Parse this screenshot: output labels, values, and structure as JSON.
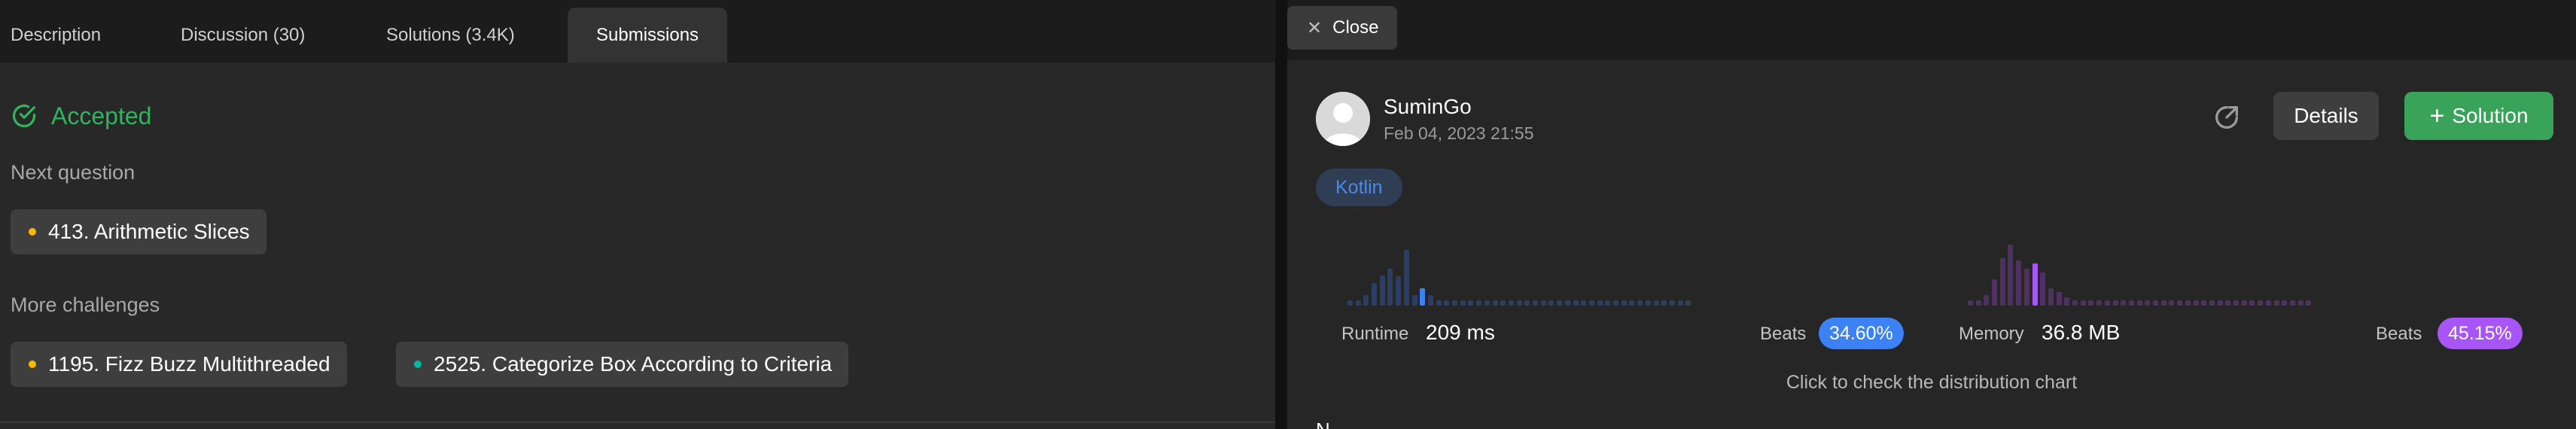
{
  "left": {
    "tabs": [
      {
        "label": "Description",
        "active": false
      },
      {
        "label": "Discussion (30)",
        "active": false
      },
      {
        "label": "Solutions (3.4K)",
        "active": false
      },
      {
        "label": "Submissions",
        "active": true
      }
    ],
    "status": {
      "label": "Accepted",
      "color": "#2db55d"
    },
    "next_question": {
      "heading": "Next question",
      "item": {
        "label": "413. Arithmetic Slices",
        "dot_color": "#ffb800",
        "difficulty": "medium"
      }
    },
    "more_challenges": {
      "heading": "More challenges",
      "items": [
        {
          "label": "1195. Fizz Buzz Multithreaded",
          "dot_color": "#ffb800",
          "difficulty": "medium"
        },
        {
          "label": "2525. Categorize Box According to Criteria",
          "dot_color": "#00b8a3",
          "difficulty": "easy"
        }
      ]
    }
  },
  "right": {
    "close_label": "Close",
    "user": {
      "name": "SuminGo",
      "date": "Feb 04, 2023 21:55"
    },
    "actions": {
      "details_label": "Details",
      "solution_label": "Solution"
    },
    "language": "Kotlin",
    "runtime": {
      "label": "Runtime",
      "value": "209 ms",
      "beats_label": "Beats",
      "beats": "34.60%",
      "accent": "#3b82f6",
      "bars": [
        0.08,
        0.08,
        0.16,
        0.34,
        0.46,
        0.56,
        0.44,
        0.84,
        0.16,
        0.26,
        0.16,
        0.08,
        0.08,
        0.08,
        0.08,
        0.08,
        0.08,
        0.08,
        0.08,
        0.08,
        0.08,
        0.08,
        0.08,
        0.08,
        0.08,
        0.08,
        0.08,
        0.08,
        0.08,
        0.08,
        0.08,
        0.08,
        0.08,
        0.08,
        0.08,
        0.08,
        0.08,
        0.08,
        0.08,
        0.08,
        0.08,
        0.08,
        0.08
      ],
      "highlight_index": 9
    },
    "memory": {
      "label": "Memory",
      "value": "36.8 MB",
      "beats_label": "Beats",
      "beats": "45.15%",
      "accent": "#a855f7",
      "bars": [
        0.08,
        0.08,
        0.16,
        0.4,
        0.72,
        0.92,
        0.68,
        0.56,
        0.64,
        0.5,
        0.26,
        0.2,
        0.12,
        0.08,
        0.08,
        0.08,
        0.08,
        0.08,
        0.08,
        0.08,
        0.08,
        0.08,
        0.08,
        0.08,
        0.08,
        0.08,
        0.08,
        0.08,
        0.08,
        0.08,
        0.08,
        0.08,
        0.08,
        0.08,
        0.08,
        0.08,
        0.08,
        0.08,
        0.08,
        0.08,
        0.08,
        0.08,
        0.08
      ],
      "highlight_index": 8
    },
    "hint": "Click to check the distribution chart"
  }
}
